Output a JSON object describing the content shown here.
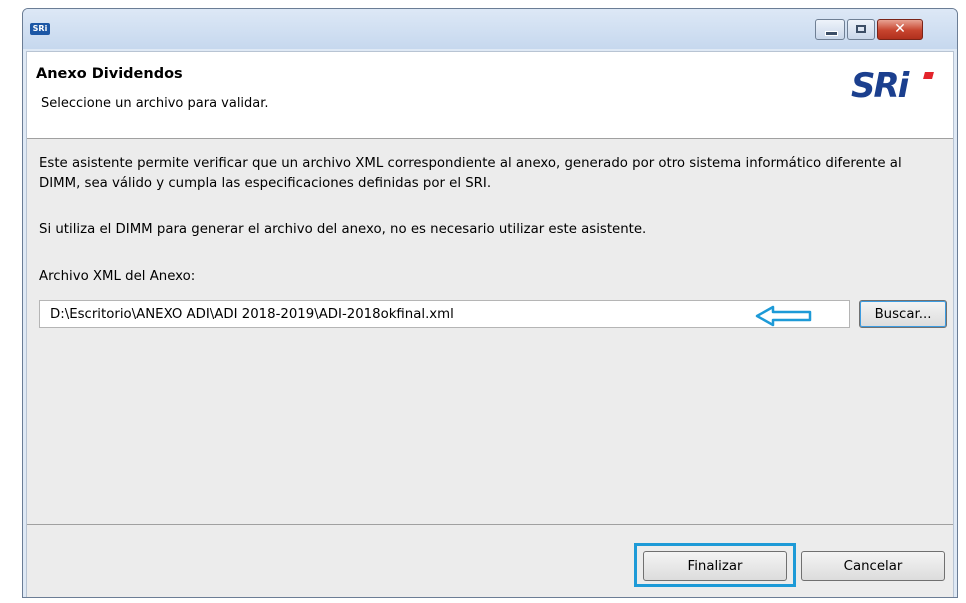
{
  "window": {
    "app_icon_text": "SRi",
    "controls": {
      "minimize": "minimize",
      "maximize": "maximize",
      "close": "✕"
    }
  },
  "header": {
    "title": "Anexo Dividendos",
    "subtitle": "Seleccione un archivo para validar.",
    "logo_text": "SRi"
  },
  "body": {
    "description": "Este asistente permite verificar que un archivo XML correspondiente al anexo, generado por otro sistema informático diferente al DIMM, sea válido y cumpla las especificaciones definidas por el SRI.",
    "note": "Si utiliza el DIMM para generar el archivo del anexo, no es necesario utilizar este asistente.",
    "field_label": "Archivo XML del Anexo:",
    "file_path": "D:\\Escritorio\\ANEXO ADI\\ADI 2018-2019\\ADI-2018okfinal.xml",
    "browse_label": "Buscar..."
  },
  "footer": {
    "finish_label": "Finalizar",
    "cancel_label": "Cancelar"
  },
  "colors": {
    "highlight": "#1d9ad7",
    "logo_blue": "#1b3f8e",
    "logo_red": "#e3242b"
  }
}
